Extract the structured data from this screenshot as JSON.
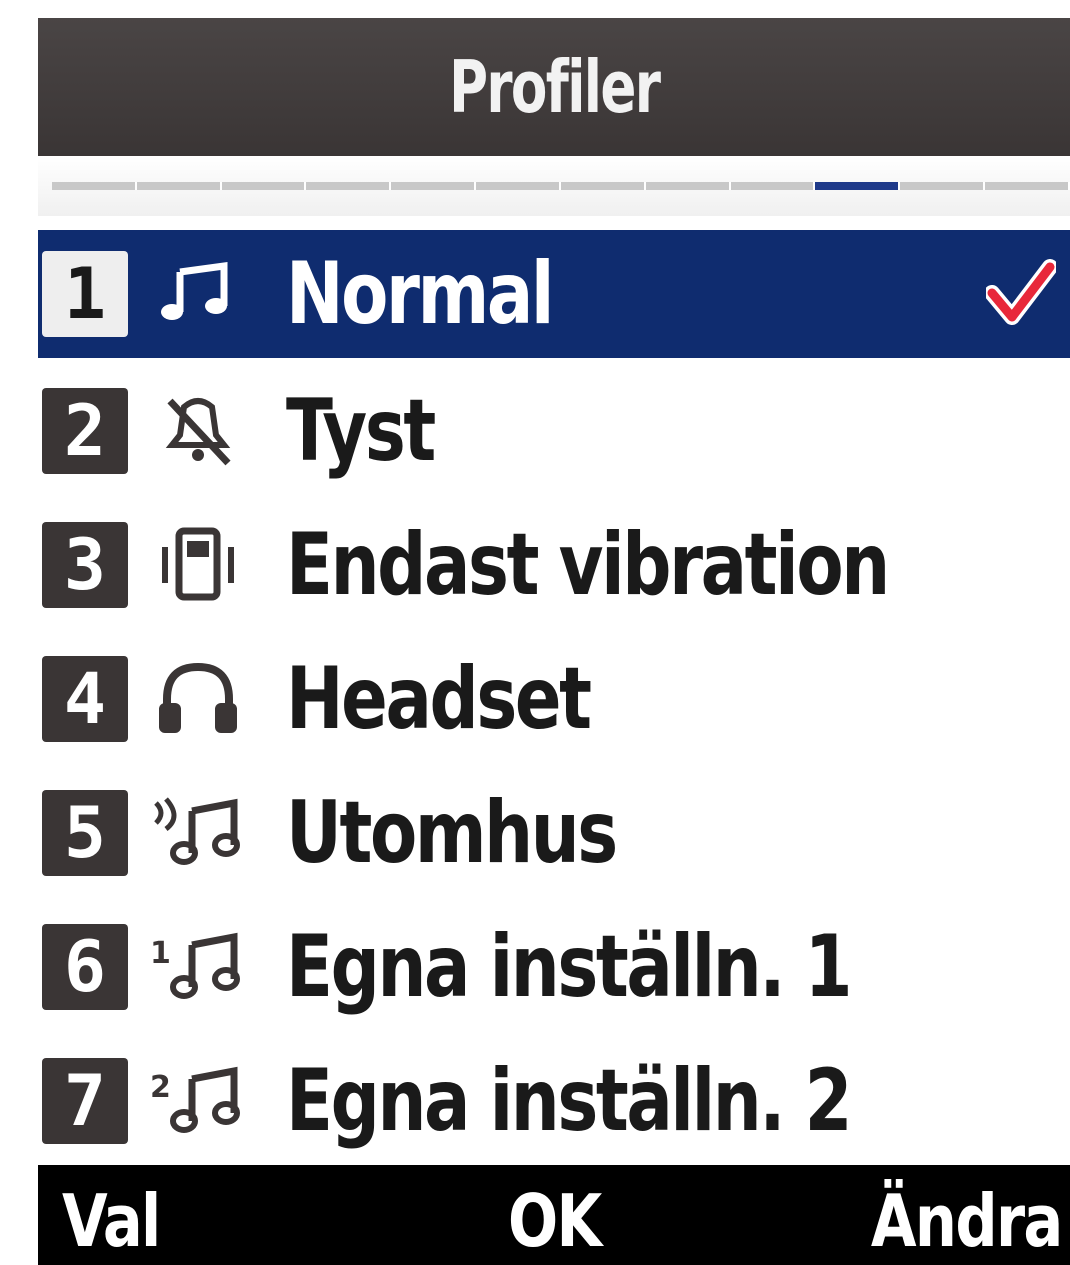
{
  "title": "Profiler",
  "tabs": {
    "count": 12,
    "active_index": 9
  },
  "profiles": [
    {
      "number": "1",
      "label": "Normal",
      "icon": "music-note-icon",
      "selected": true,
      "checked": true
    },
    {
      "number": "2",
      "label": "Tyst",
      "icon": "muted-bell-icon",
      "selected": false,
      "checked": false
    },
    {
      "number": "3",
      "label": "Endast vibration",
      "icon": "vibrate-phone-icon",
      "selected": false,
      "checked": false
    },
    {
      "number": "4",
      "label": "Headset",
      "icon": "headset-icon",
      "selected": false,
      "checked": false
    },
    {
      "number": "5",
      "label": "Utomhus",
      "icon": "outdoor-loud-icon",
      "selected": false,
      "checked": false
    },
    {
      "number": "6",
      "label": "Egna inställn. 1",
      "icon": "custom-1-icon",
      "selected": false,
      "checked": false
    },
    {
      "number": "7",
      "label": "Egna inställn. 2",
      "icon": "custom-2-icon",
      "selected": false,
      "checked": false
    }
  ],
  "softkeys": {
    "left": "Val",
    "center": "OK",
    "right": "Ändra"
  },
  "colors": {
    "title_bar": "#3f3a3a",
    "selection": "#0f2c6f",
    "active_tab": "#1f3a8a",
    "check": "#e8283a",
    "softkey_bar": "#000000"
  }
}
